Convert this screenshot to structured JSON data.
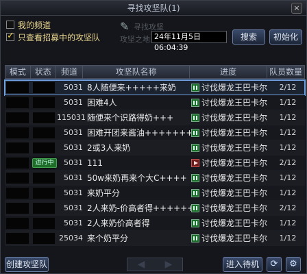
{
  "window": {
    "title": "寻找攻坚队(1)",
    "close_label": "×"
  },
  "filters": {
    "my_channel_label": "我的频道",
    "recruiting_only_label": "只查看招募中的攻坚队"
  },
  "search": {
    "faded_label_1": "寻找攻坚",
    "faded_label_2": "攻坚之地",
    "date_value": "24年11月5日06:04:39",
    "search_button": "搜索",
    "reset_button": "初始化"
  },
  "table": {
    "headers": {
      "mode": "模式",
      "status": "状态",
      "channel": "频道",
      "name": "攻坚队名称",
      "progress": "进度",
      "members": "队员数量"
    },
    "rows": [
      {
        "channel": "5031",
        "name": "8人随便来+++++来奶",
        "progress": "讨伐爆龙王巴卡尔",
        "members": "2/12",
        "icon": "pause"
      },
      {
        "channel": "5031",
        "name": "困难4人",
        "progress": "讨伐爆龙王巴卡尔",
        "members": "1/12",
        "icon": "pause"
      },
      {
        "channel": "115031",
        "name": "随便来个识路得奶+++",
        "progress": "讨伐爆龙王巴卡尔",
        "members": "1/12",
        "icon": "pause"
      },
      {
        "channel": "5031",
        "name": "困难开团来酱油+++++++",
        "progress": "讨伐爆龙王巴卡尔",
        "members": "1/12",
        "icon": "pause"
      },
      {
        "channel": "5031",
        "name": "2或3人来奶",
        "progress": "讨伐爆龙王巴卡尔",
        "members": "1/12",
        "icon": "pause"
      },
      {
        "channel": "5031",
        "name": "111",
        "progress": "讨伐爆龙王巴卡尔",
        "members": "2/12",
        "icon": "play",
        "status_badge": "进行中"
      },
      {
        "channel": "5031",
        "name": "50w来奶再来个大C++++",
        "progress": "讨伐爆龙王巴卡尔",
        "members": "1/12",
        "icon": "pause"
      },
      {
        "channel": "5031",
        "name": "来奶平分",
        "progress": "讨伐爆龙王巴卡尔",
        "members": "1/12",
        "icon": "pause"
      },
      {
        "channel": "5031",
        "name": "2人来奶-价高者得+++++++",
        "progress": "讨伐爆龙王巴卡尔",
        "members": "2/12",
        "icon": "pause"
      },
      {
        "channel": "5031",
        "name": "2人来奶价高者得",
        "progress": "讨伐爆龙王巴卡尔",
        "members": "1/12",
        "icon": "pause"
      },
      {
        "channel": "25034",
        "name": "来个奶平分",
        "progress": "讨伐爆龙王巴卡尔",
        "members": "1/12",
        "icon": "pause"
      }
    ]
  },
  "bottom": {
    "create_button": "创建攻坚队",
    "prev_arrow": "◀",
    "next_arrow": "▶",
    "enter_button": "进入待机",
    "refresh_icon": "refresh-icon",
    "settings_icon": "gear-icon"
  }
}
